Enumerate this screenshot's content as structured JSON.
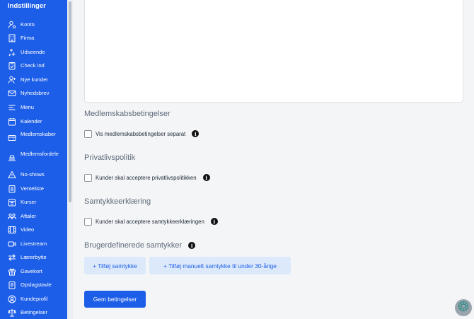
{
  "sidebar": {
    "title": "Indstillinger",
    "items": [
      {
        "label": "Konto",
        "icon": "user-settings-icon"
      },
      {
        "label": "Firma",
        "icon": "building-icon"
      },
      {
        "label": "Udseende",
        "icon": "sparkles-icon"
      },
      {
        "label": "Check ind",
        "icon": "clipboard-check-icon"
      },
      {
        "label": "Nye kunder",
        "icon": "user-plus-icon"
      },
      {
        "label": "Nyhedsbrev",
        "icon": "mail-icon"
      },
      {
        "label": "Menu",
        "icon": "menu-icon"
      },
      {
        "label": "Kalender",
        "icon": "calendar-icon"
      },
      {
        "label": "Medlemskaber",
        "icon": "card-icon"
      },
      {
        "label": "Medlemsfordele",
        "icon": "perks-icon"
      },
      {
        "label": "No-shows",
        "icon": "warning-icon"
      },
      {
        "label": "Venteliste",
        "icon": "list-icon"
      },
      {
        "label": "Kurser",
        "icon": "course-calendar-icon"
      },
      {
        "label": "Aftaler",
        "icon": "users-icon"
      },
      {
        "label": "Video",
        "icon": "film-icon"
      },
      {
        "label": "Livestream",
        "icon": "video-camera-icon"
      },
      {
        "label": "Lærerbytte",
        "icon": "swap-icon"
      },
      {
        "label": "Gavekort",
        "icon": "gift-icon"
      },
      {
        "label": "Opslagstavle",
        "icon": "board-icon"
      },
      {
        "label": "Kundeprofil",
        "icon": "profile-icon"
      },
      {
        "label": "Betingelser",
        "icon": "scale-icon"
      }
    ]
  },
  "sections": {
    "membership": {
      "title": "Medlemskabsbetingelser",
      "checkbox_label": "Vis medlemskabsbetingelser separat",
      "checked": false
    },
    "privacy": {
      "title": "Privatlivspolitik",
      "checkbox_label": "Kunder skal acceptere privatlivspolitikken",
      "checked": false
    },
    "consent": {
      "title": "Samtykkeerklæring",
      "checkbox_label": "Kunder skal acceptere samtykkeerklæringen",
      "checked": false
    },
    "custom": {
      "title": "Brugerdefinerede samtykker",
      "add_consent_label": "+ Tilføj samtykke",
      "add_manual_label": "+ Tilføj manuelt samtykke til under 30-årige"
    }
  },
  "actions": {
    "save_label": "Gem betingelser"
  },
  "colors": {
    "accent": "#1d5ee8",
    "sidebar_bg": "#1d5ee8",
    "pill_bg": "#dce9fb",
    "section_title": "#5f6b7a"
  }
}
